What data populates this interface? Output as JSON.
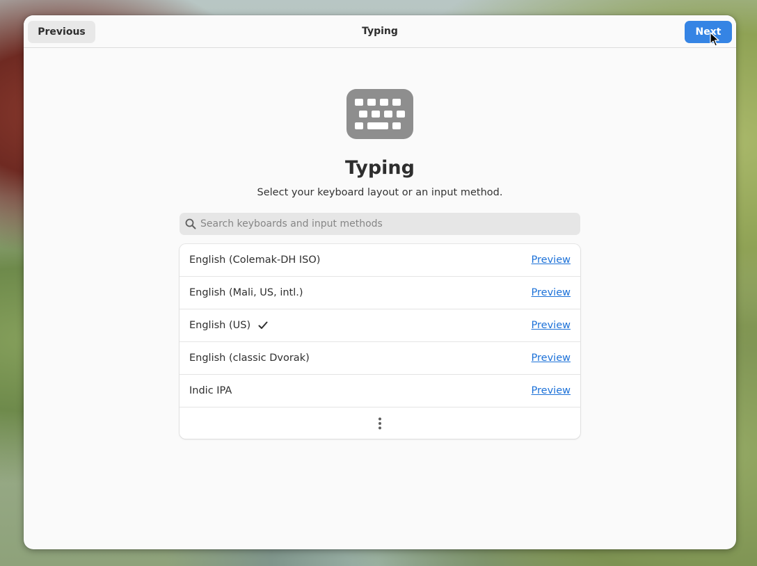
{
  "header": {
    "title": "Typing",
    "previous_label": "Previous",
    "next_label": "Next"
  },
  "hero": {
    "icon": "keyboard-icon",
    "title": "Typing",
    "subtitle": "Select your keyboard layout or an input method."
  },
  "search": {
    "placeholder": "Search keyboards and input methods",
    "value": ""
  },
  "layouts": [
    {
      "label": "English (Colemak-DH ISO)",
      "selected": false,
      "preview_label": "Preview"
    },
    {
      "label": "English (Mali, US, intl.)",
      "selected": false,
      "preview_label": "Preview"
    },
    {
      "label": "English (US)",
      "selected": true,
      "preview_label": "Preview"
    },
    {
      "label": "English (classic Dvorak)",
      "selected": false,
      "preview_label": "Preview"
    },
    {
      "label": "Indic IPA",
      "selected": false,
      "preview_label": "Preview"
    }
  ],
  "more_button": {
    "icon": "view-more-icon"
  },
  "colors": {
    "accent": "#3584e4",
    "link": "#1c71d8",
    "window_bg": "#fafafa",
    "icon_gray": "#8e8e8e"
  }
}
